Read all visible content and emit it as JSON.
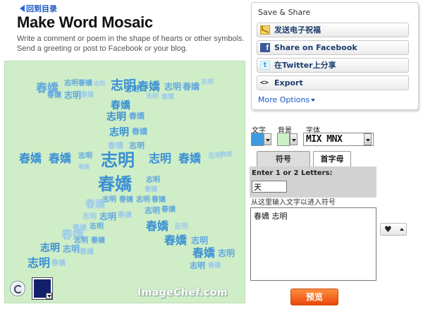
{
  "header": {
    "back_link": "回到目录",
    "title": "Make Word Mosaic",
    "description": "Write a comment or poem in the shape of hearts or other symbols. Send a greeting or post to Facebook or your blog."
  },
  "mosaic": {
    "word_a": "春嬌",
    "word_b": "志明",
    "watermark": "ImageChef.com",
    "background_color": "#cfeec8",
    "text_color": "#3a8fd4",
    "swatch_color": "#12206a"
  },
  "share": {
    "title": "Save & Share",
    "email_label": "发送电子祝福",
    "facebook_label": "Share on Facebook",
    "twitter_label": "在Twitter上分享",
    "export_label": "Export",
    "more_options": "More Options"
  },
  "controls": {
    "text_label": "文字",
    "bg_label": "背景",
    "font_label": "字体",
    "font_value": "MIX MNX",
    "text_color": "#3b9be0",
    "bg_color": "#ccefc8"
  },
  "tabs": {
    "symbol": "符号",
    "initial": "首字母"
  },
  "letters": {
    "label": "Enter 1 or 2 Letters:",
    "value": "天"
  },
  "entry": {
    "hint": "从这里输入文字以进入符号",
    "value": "春嬌 志明"
  },
  "shape_symbol": "♥",
  "preview_label": "预览"
}
